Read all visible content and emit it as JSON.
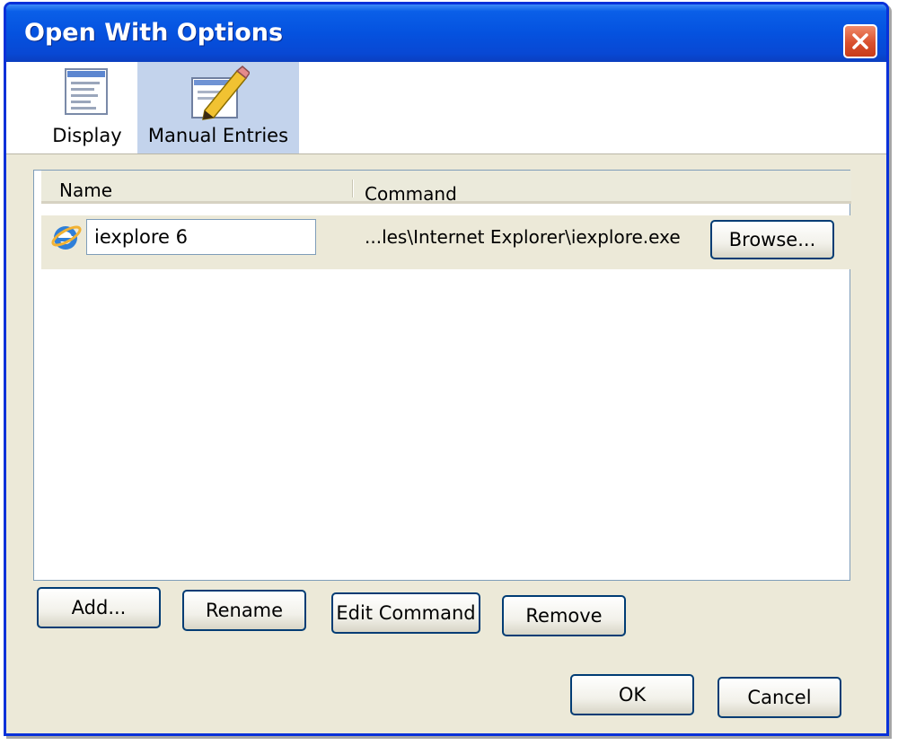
{
  "window": {
    "title": "Open With Options"
  },
  "toolbar": {
    "tabs": [
      {
        "label": "Display",
        "icon": "display-page-icon"
      },
      {
        "label": "Manual Entries",
        "icon": "pencil-edit-icon",
        "selected": true
      }
    ]
  },
  "list": {
    "headers": {
      "name": "Name",
      "command": "Command"
    },
    "rows": [
      {
        "icon": "internet-explorer-icon",
        "name": "iexplore 6",
        "command": "...les\\Internet Explorer\\iexplore.exe",
        "browse_label": "Browse..."
      }
    ]
  },
  "actions": {
    "add": "Add...",
    "rename": "Rename",
    "edit_command": "Edit Command",
    "remove": "Remove"
  },
  "footer": {
    "ok": "OK",
    "cancel": "Cancel"
  },
  "colors": {
    "titlebar": "#0552df",
    "window_border": "#0831d9",
    "dialog_bg": "#ece9d8",
    "selected_tab": "#c3d3ec",
    "close_button": "#d9502e"
  }
}
